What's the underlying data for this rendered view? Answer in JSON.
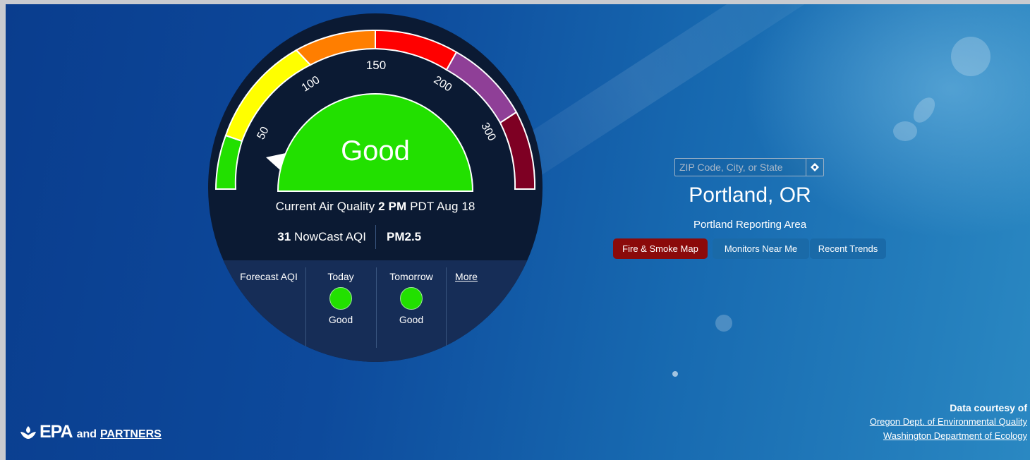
{
  "gauge": {
    "category": "Good",
    "ticks": [
      "50",
      "100",
      "150",
      "200",
      "300"
    ],
    "current_label": "Current Air Quality",
    "current_time": "2 PM",
    "current_date": "PDT Aug 18",
    "aqi_value": "31",
    "aqi_label": "NowCast AQI",
    "pollutant": "PM2.5",
    "category_colors": {
      "good": "#22e000",
      "moderate": "#ffff00",
      "usg": "#ff7e00",
      "unhealthy": "#ff0000",
      "very_unhealthy": "#8f3f97",
      "hazardous": "#7e0023"
    }
  },
  "forecast": {
    "label": "Forecast AQI",
    "days": [
      {
        "name": "Today",
        "status": "Good"
      },
      {
        "name": "Tomorrow",
        "status": "Good"
      }
    ],
    "more_label": "More"
  },
  "search": {
    "placeholder": "ZIP Code, City, or State",
    "icon": "locate-icon"
  },
  "location": {
    "city": "Portland, OR",
    "area": "Portland Reporting Area"
  },
  "actions": {
    "fire_smoke": "Fire & Smoke Map",
    "monitors": "Monitors Near Me",
    "trends": "Recent Trends"
  },
  "footer": {
    "logo_text": "EPA",
    "and_text": "and",
    "partners_text": "PARTNERS",
    "credit_heading": "Data courtesy of",
    "credit_links": [
      "Oregon Dept. of Environmental Quality",
      "Washington Department of Ecology"
    ]
  }
}
